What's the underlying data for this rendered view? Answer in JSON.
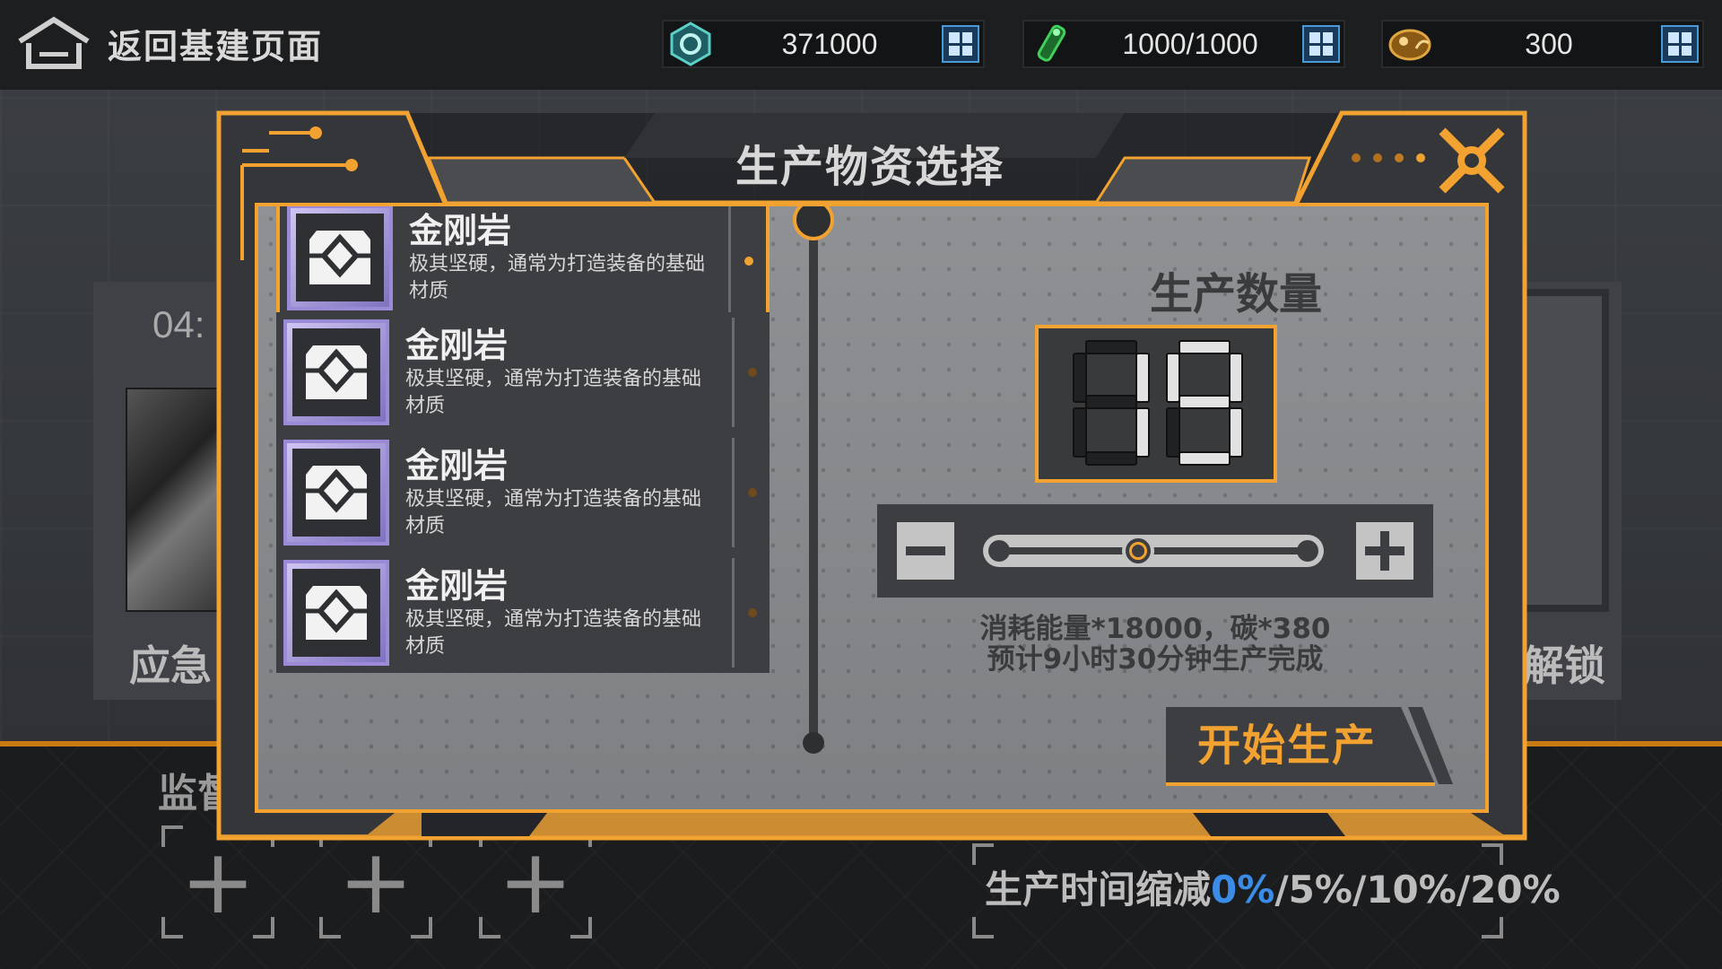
{
  "topbar": {
    "back_label": "返回基建页面",
    "resources": [
      {
        "icon": "gear-crystal-icon",
        "value": "371000",
        "color": "#5ad0c6"
      },
      {
        "icon": "green-tube-icon",
        "value": "1000/1000",
        "color": "#3fd05a"
      },
      {
        "icon": "yellow-creature-icon",
        "value": "300",
        "color": "#e0a640"
      }
    ]
  },
  "background": {
    "left_card_time": "04:",
    "left_card_label": "应急",
    "right_card_label": "解锁",
    "monitor_label": "监督",
    "reduction": {
      "prefix": "生产时间缩减",
      "active": "0%",
      "rest": "/5%/10%/20%"
    }
  },
  "dialog": {
    "title": "生产物资选择",
    "items": [
      {
        "name": "金刚岩",
        "desc": "极其坚硬，通常为打造装备的基础材质",
        "selected": true
      },
      {
        "name": "金刚岩",
        "desc": "极其坚硬，通常为打造装备的基础材质",
        "selected": false
      },
      {
        "name": "金刚岩",
        "desc": "极其坚硬，通常为打造装备的基础材质",
        "selected": false
      },
      {
        "name": "金刚岩",
        "desc": "极其坚硬，通常为打造装备的基础材质",
        "selected": false
      }
    ],
    "quantity_label": "生产数量",
    "quantity_value": "19",
    "slider_fraction": 0.45,
    "cost_line1": "消耗能量*18000，碳*380",
    "cost_line2": "预计9小时30分钟生产完成",
    "start_label": "开始生产",
    "accent": "#f2a230"
  }
}
